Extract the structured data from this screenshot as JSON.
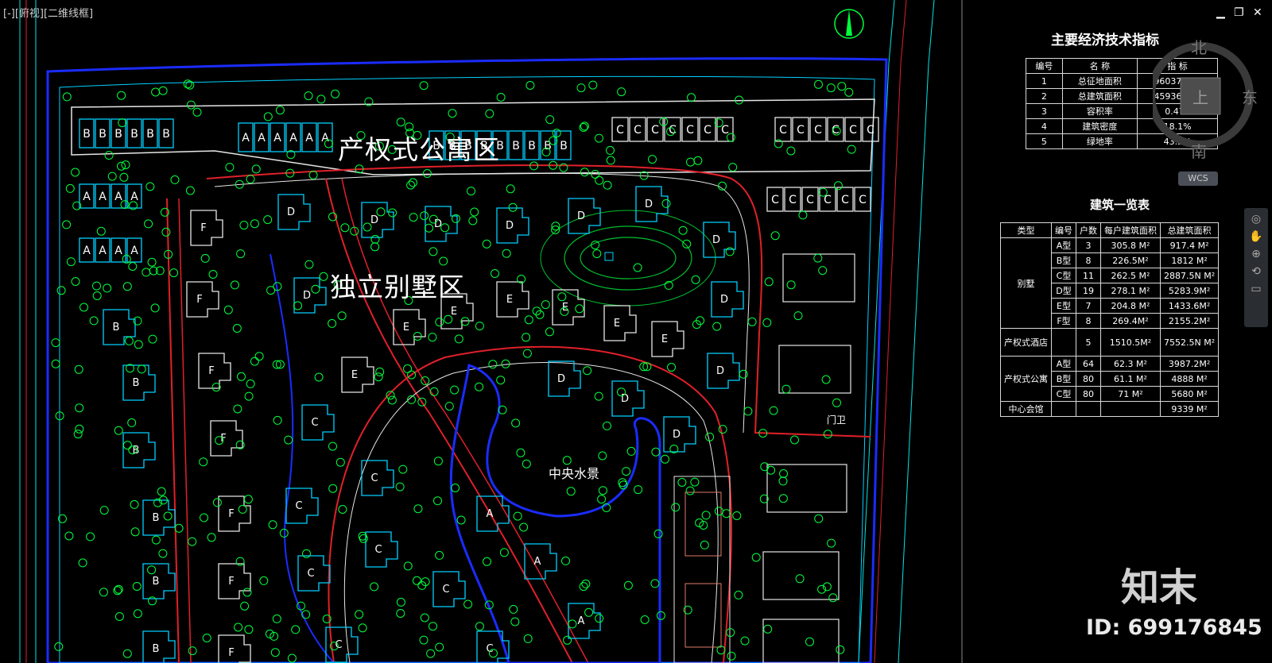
{
  "viewport": {
    "label": "[-][俯视][二维线框]"
  },
  "zones": {
    "apartment": "产权式公寓区",
    "villa": "独立别墅区",
    "water": "中央水景",
    "gate": "门卫"
  },
  "compass": {
    "north": "北",
    "south": "南",
    "east": "东",
    "top": "上"
  },
  "wcs": "WCS",
  "tech_table": {
    "title": "主要经济技术指标",
    "headers": [
      "编号",
      "名 称",
      "指 标"
    ],
    "rows": [
      [
        "1",
        "总征地面积",
        "96037.6M²"
      ],
      [
        "2",
        "总建筑面积",
        "45936.3M²"
      ],
      [
        "3",
        "容积率",
        "0.478"
      ],
      [
        "4",
        "建筑密度",
        "18.1%"
      ],
      [
        "5",
        "绿地率",
        "43.2%"
      ]
    ]
  },
  "building_table": {
    "title": "建筑一览表",
    "headers": [
      "类型",
      "编号",
      "户数",
      "每户建筑面积",
      "总建筑面积"
    ],
    "villa_label": "别墅",
    "villa_rows": [
      [
        "A型",
        "3",
        "305.8 M²",
        "917.4 M²"
      ],
      [
        "B型",
        "8",
        "226.5M²",
        "1812 M²"
      ],
      [
        "C型",
        "11",
        "262.5 M²",
        "2887.5N M²"
      ],
      [
        "D型",
        "19",
        "278.1 M²",
        "5283.9M²"
      ],
      [
        "E型",
        "7",
        "204.8 M²",
        "1433.6M²"
      ],
      [
        "F型",
        "8",
        "269.4M²",
        "2155.2M²"
      ]
    ],
    "hotel": [
      "产权式酒店",
      "",
      "5",
      "1510.5M²",
      "7552.5N M²"
    ],
    "apt_label": "产权式公寓",
    "apt_rows": [
      [
        "A型",
        "64",
        "62.3 M²",
        "3987.2M²"
      ],
      [
        "B型",
        "80",
        "61.1 M²",
        "4888 M²"
      ],
      [
        "C型",
        "80",
        "71 M²",
        "5680 M²"
      ]
    ],
    "center": [
      "中心会馆",
      "",
      "",
      "",
      "9339 M²"
    ]
  },
  "brand": {
    "name": "知末",
    "id": "ID: 699176845"
  },
  "colors": {
    "tree": "#00ff3c",
    "water": "#1a2cff",
    "road": "#e0202a",
    "building": "#00d0ff",
    "bg": "#000000"
  }
}
